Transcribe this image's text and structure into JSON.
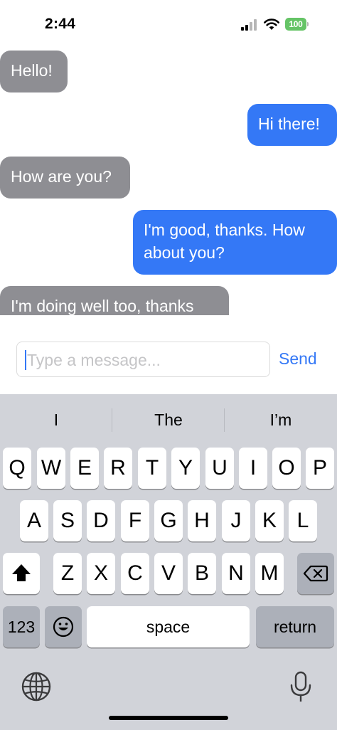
{
  "status_bar": {
    "time": "2:44",
    "battery_level": "100",
    "battery_color": "#65c466"
  },
  "messages": [
    {
      "text": "Hello!",
      "direction": "received"
    },
    {
      "text": "Hi there!",
      "direction": "sent"
    },
    {
      "text": "How are you?",
      "direction": "received"
    },
    {
      "text": "I'm good, thanks. How about you?",
      "direction": "sent"
    },
    {
      "text": "I'm doing well too, thanks",
      "direction": "received"
    }
  ],
  "composer": {
    "placeholder": "Type a message...",
    "send_label": "Send"
  },
  "keyboard": {
    "suggestions": [
      "I",
      "The",
      "I’m"
    ],
    "row1": [
      "Q",
      "W",
      "E",
      "R",
      "T",
      "Y",
      "U",
      "I",
      "O",
      "P"
    ],
    "row2": [
      "A",
      "S",
      "D",
      "F",
      "G",
      "H",
      "J",
      "K",
      "L"
    ],
    "row3": [
      "Z",
      "X",
      "C",
      "V",
      "B",
      "N",
      "M"
    ],
    "numbers_label": "123",
    "space_label": "space",
    "return_label": "return",
    "icons": [
      "shift-icon",
      "backspace-icon",
      "emoji-icon",
      "globe-icon",
      "microphone-icon"
    ]
  },
  "colors": {
    "sent_bubble": "#3478f6",
    "received_bubble": "#8e8e93",
    "accent": "#3478f6",
    "keyboard_bg": "#d1d3d9"
  }
}
